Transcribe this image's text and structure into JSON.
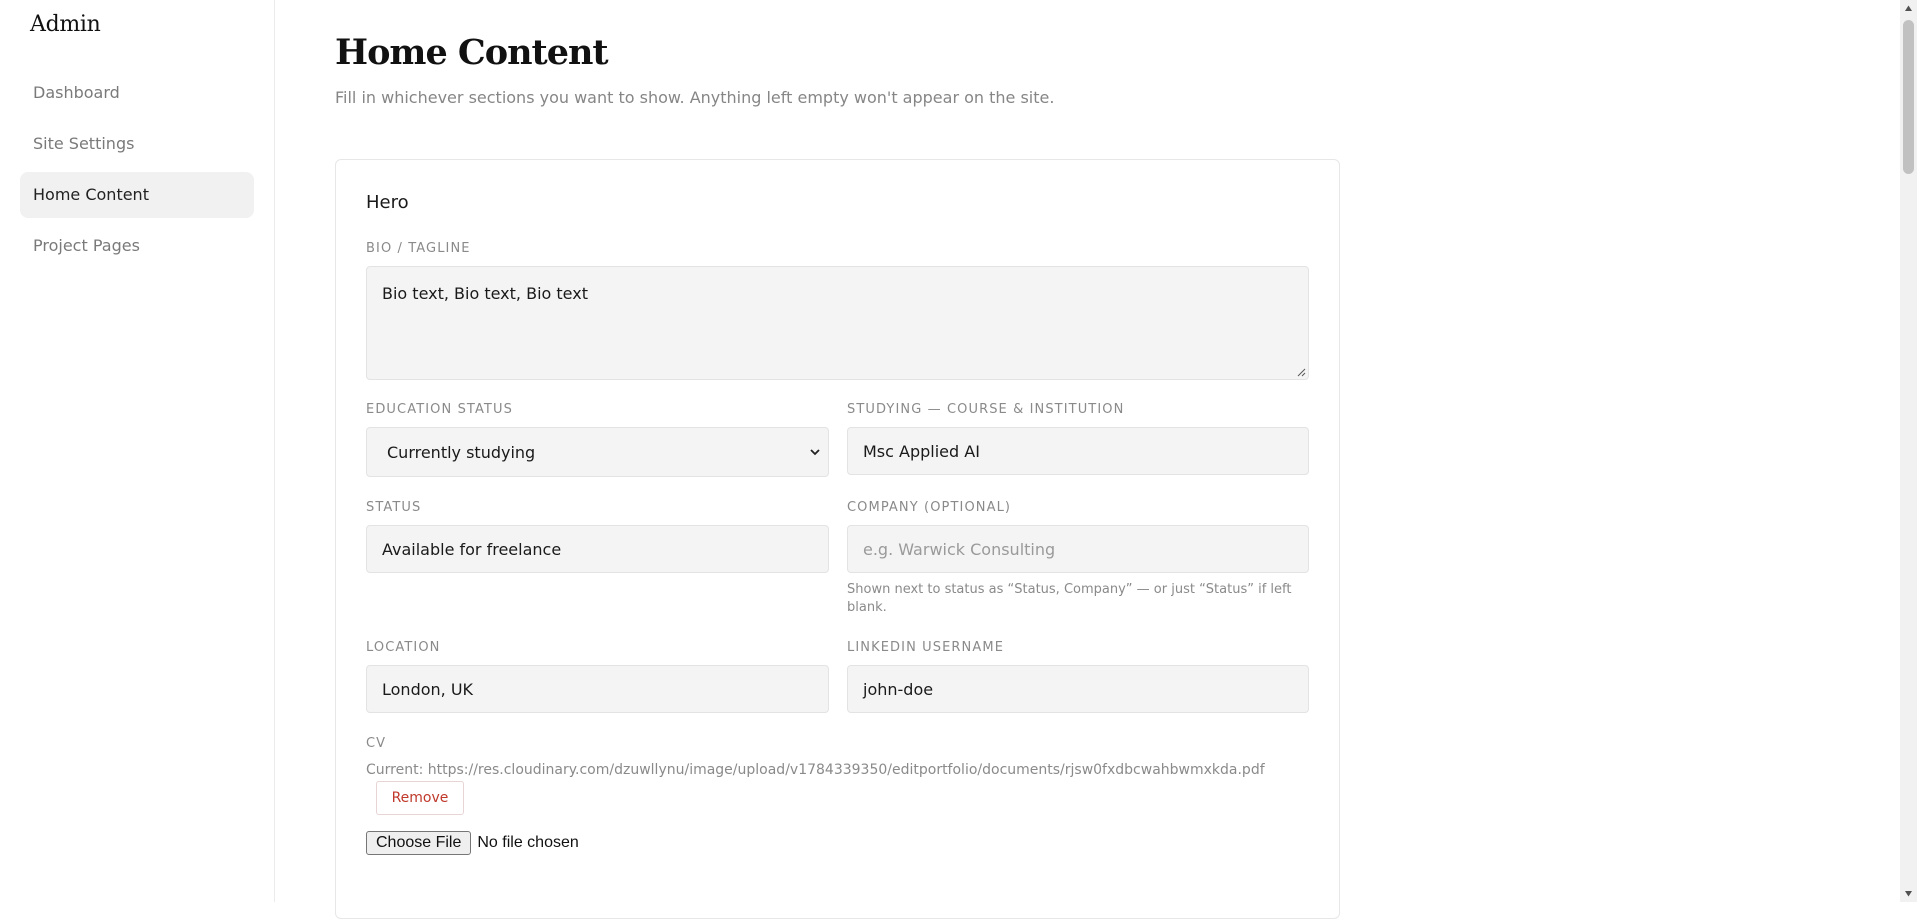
{
  "sidebar": {
    "brand": "Admin",
    "items": [
      {
        "label": "Dashboard"
      },
      {
        "label": "Site Settings"
      },
      {
        "label": "Home Content"
      },
      {
        "label": "Project Pages"
      }
    ],
    "active_item": "Home Content"
  },
  "page": {
    "title": "Home Content",
    "subtitle": "Fill in whichever sections you want to show. Anything left empty won't appear on the site."
  },
  "hero": {
    "section_title": "Hero",
    "bio": {
      "label": "BIO / TAGLINE",
      "value": "Bio text, Bio text, Bio text"
    },
    "education_status": {
      "label": "EDUCATION STATUS",
      "selected": "Currently studying"
    },
    "studying": {
      "label": "STUDYING — COURSE & INSTITUTION",
      "value": "Msc Applied AI"
    },
    "status": {
      "label": "STATUS",
      "value": "Available for freelance"
    },
    "company": {
      "label": "COMPANY (OPTIONAL)",
      "placeholder": "e.g. Warwick Consulting",
      "hint": "Shown next to status as “Status, Company” — or just “Status” if left blank."
    },
    "location": {
      "label": "LOCATION",
      "value": "London, UK"
    },
    "linkedin": {
      "label": "LINKEDIN USERNAME",
      "value": "john-doe"
    },
    "cv": {
      "label": "CV",
      "current": "Current: https://res.cloudinary.com/dzuwllynu/image/upload/v1784339350/editportfolio/documents/rjsw0fxdbcwahbwmxkda.pdf",
      "remove_label": "Remove",
      "choose_label": "Choose File",
      "no_file_label": "No file chosen"
    }
  },
  "colors": {
    "accent_remove": "#c0392b",
    "active_nav_bg": "#f1f1f1",
    "field_bg": "#f4f4f4"
  },
  "icons": [
    "chevron-down-icon",
    "resize-grip-icon",
    "scroll-up-arrow-icon",
    "scroll-down-arrow-icon"
  ]
}
